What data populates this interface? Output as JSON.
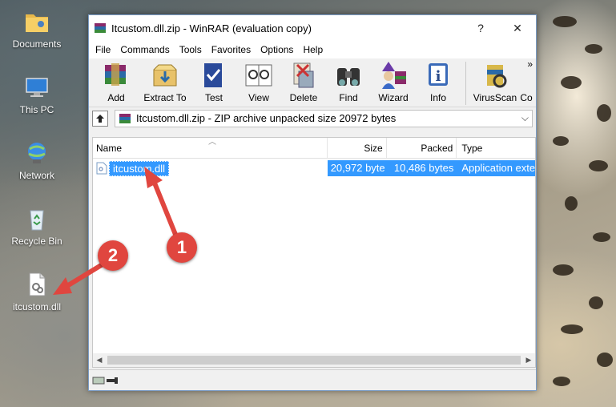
{
  "desktop": {
    "icons": [
      {
        "label": "Documents"
      },
      {
        "label": "This PC"
      },
      {
        "label": "Network"
      },
      {
        "label": "Recycle Bin"
      },
      {
        "label": "itcustom.dll"
      }
    ]
  },
  "window": {
    "title": "Itcustom.dll.zip - WinRAR (evaluation copy)",
    "help_btn": "?",
    "close_btn": "✕",
    "menu": [
      "File",
      "Commands",
      "Tools",
      "Favorites",
      "Options",
      "Help"
    ],
    "toolbar": [
      {
        "label": "Add",
        "icon": "add-archive-icon"
      },
      {
        "label": "Extract To",
        "icon": "extract-icon"
      },
      {
        "label": "Test",
        "icon": "test-icon"
      },
      {
        "label": "View",
        "icon": "view-icon"
      },
      {
        "label": "Delete",
        "icon": "delete-icon"
      },
      {
        "label": "Find",
        "icon": "find-icon"
      },
      {
        "label": "Wizard",
        "icon": "wizard-icon"
      },
      {
        "label": "Info",
        "icon": "info-icon"
      },
      {
        "label": "VirusScan",
        "icon": "virusscan-icon"
      },
      {
        "label": "Co",
        "icon": "comment-icon"
      }
    ],
    "toolbar_more": "»",
    "address": "Itcustom.dll.zip - ZIP archive unpacked size 20972 bytes",
    "columns": [
      "Name",
      "Size",
      "Packed",
      "Type"
    ],
    "files": [
      {
        "name": "itcustom.dll",
        "size": "20,972 byte",
        "packed": "10,486 bytes",
        "type": "Application exte"
      }
    ]
  },
  "annotations": {
    "step1": "1",
    "step2": "2",
    "color": "#e0463f"
  },
  "colors": {
    "selection": "#3399ff",
    "selection_text": "#ffffff"
  }
}
